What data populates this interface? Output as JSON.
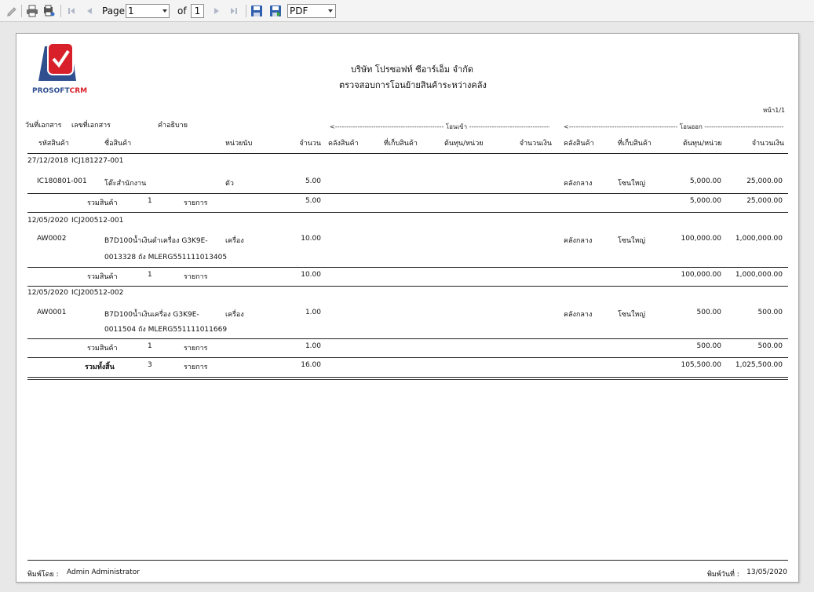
{
  "toolbar": {
    "page_label": "Page",
    "page_value": "1",
    "of_label": "of",
    "total_pages": "1",
    "format_value": "PDF"
  },
  "report": {
    "logo_text_1": "PROSOFT",
    "logo_text_2": "CRM",
    "company": "บริษัท โปรซอฟท์ ซีอาร์เอ็ม จำกัด",
    "title": "ตรวจสอบการโอนย้ายสินค้าระหว่างคลัง",
    "page_no": "หน้า1/1",
    "headers": {
      "doc_date": "วันที่เอกสาร",
      "doc_no": "เลขที่เอกสาร",
      "desc": "คำอธิบาย",
      "in_group": "<------------------------------------------------ โอนเข้า ------------------------------------------------>",
      "out_group": "<------------------------------------------------ โอนออก ------------------------------------------------>",
      "item_code": "รหัสสินค้า",
      "item_name": "ชื่อสินค้า",
      "unit": "หน่วยนับ",
      "qty": "จำนวน",
      "in_wh": "คลังสินค้า",
      "in_loc": "ที่เก็บสินค้า",
      "in_cost": "ต้นทุน/หน่วย",
      "in_amount": "จำนวนเงิน",
      "out_wh": "คลังสินค้า",
      "out_loc": "ที่เก็บสินค้า",
      "out_cost": "ต้นทุน/หน่วย",
      "out_amount": "จำนวนเงิน"
    },
    "groups": [
      {
        "date": "27/12/2018",
        "doc": "ICJ181227-001",
        "code": "IC180801-001",
        "name1": "โต๊ะสำนักงาน",
        "name2": "",
        "unit": "ตัว",
        "qty": "5.00",
        "wh": "คลังกลาง",
        "loc": "โซนใหญ่",
        "cost": "5,000.00",
        "amount": "25,000.00",
        "sum_label": "รวมสินค้า",
        "sum_count": "1",
        "sum_unit": "รายการ",
        "sum_qty": "5.00",
        "sum_cost": "5,000.00",
        "sum_amount": "25,000.00"
      },
      {
        "date": "12/05/2020",
        "doc": "ICJ200512-001",
        "code": "AW0002",
        "name1": "B7D100น้ำเงินดำเครื่อง G3K9E-",
        "name2": "0013328 ถัง MLERG551111013405",
        "unit": "เครื่อง",
        "qty": "10.00",
        "wh": "คลังกลาง",
        "loc": "โซนใหญ่",
        "cost": "100,000.00",
        "amount": "1,000,000.00",
        "sum_label": "รวมสินค้า",
        "sum_count": "1",
        "sum_unit": "รายการ",
        "sum_qty": "10.00",
        "sum_cost": "100,000.00",
        "sum_amount": "1,000,000.00"
      },
      {
        "date": "12/05/2020",
        "doc": "ICJ200512-002",
        "code": "AW0001",
        "name1": "B7D100น้ำเงินเครื่อง G3K9E-",
        "name2": "0011504 ถัง MLERG551111011669",
        "unit": "เครื่อง",
        "qty": "1.00",
        "wh": "คลังกลาง",
        "loc": "โซนใหญ่",
        "cost": "500.00",
        "amount": "500.00",
        "sum_label": "รวมสินค้า",
        "sum_count": "1",
        "sum_unit": "รายการ",
        "sum_qty": "1.00",
        "sum_cost": "500.00",
        "sum_amount": "500.00"
      }
    ],
    "grand": {
      "label": "รวมทั้งสิ้น",
      "count": "3",
      "unit": "รายการ",
      "qty": "16.00",
      "cost": "105,500.00",
      "amount": "1,025,500.00"
    },
    "footer": {
      "printed_by_label": "พิมพ์โดย :",
      "printed_by": "Admin Administrator",
      "printed_date_label": "พิมพ์วันที่ :",
      "printed_date": "13/05/2020"
    }
  }
}
